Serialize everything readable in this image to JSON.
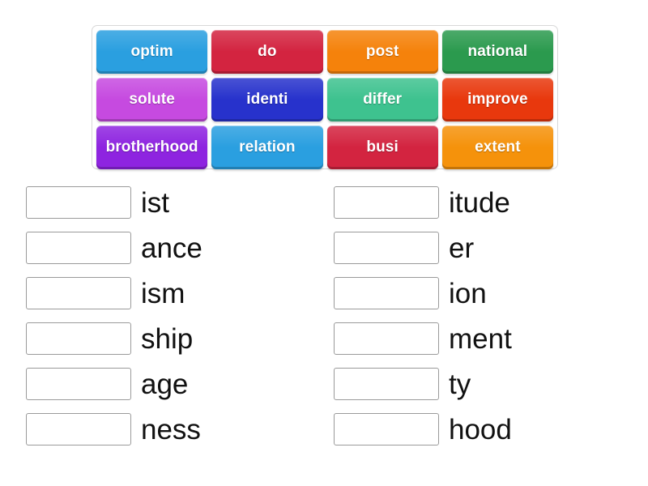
{
  "word_bank": {
    "rows": [
      [
        {
          "label": "optim",
          "color": "#2a9fe0"
        },
        {
          "label": "do",
          "color": "#d32440"
        },
        {
          "label": "post",
          "color": "#f5820b"
        },
        {
          "label": "national",
          "color": "#2b9a4e"
        }
      ],
      [
        {
          "label": "solute",
          "color": "#c64ae0"
        },
        {
          "label": "identi",
          "color": "#2732cc"
        },
        {
          "label": "differ",
          "color": "#3ec28f"
        },
        {
          "label": "improve",
          "color": "#e8380d"
        }
      ],
      [
        {
          "label": "brotherhood",
          "color": "#8e24e0"
        },
        {
          "label": "relation",
          "color": "#2a9fe0"
        },
        {
          "label": "busi",
          "color": "#d32440"
        },
        {
          "label": "extent",
          "color": "#f5920b"
        }
      ]
    ]
  },
  "answers": {
    "left_column": [
      {
        "blank_value": "",
        "suffix": "ist"
      },
      {
        "blank_value": "",
        "suffix": "ance"
      },
      {
        "blank_value": "",
        "suffix": "ism"
      },
      {
        "blank_value": "",
        "suffix": "ship"
      },
      {
        "blank_value": "",
        "suffix": "age"
      },
      {
        "blank_value": "",
        "suffix": "ness"
      }
    ],
    "right_column": [
      {
        "blank_value": "",
        "suffix": "itude"
      },
      {
        "blank_value": "",
        "suffix": "er"
      },
      {
        "blank_value": "",
        "suffix": "ion"
      },
      {
        "blank_value": "",
        "suffix": "ment"
      },
      {
        "blank_value": "",
        "suffix": "ty"
      },
      {
        "blank_value": "",
        "suffix": "hood"
      }
    ]
  }
}
